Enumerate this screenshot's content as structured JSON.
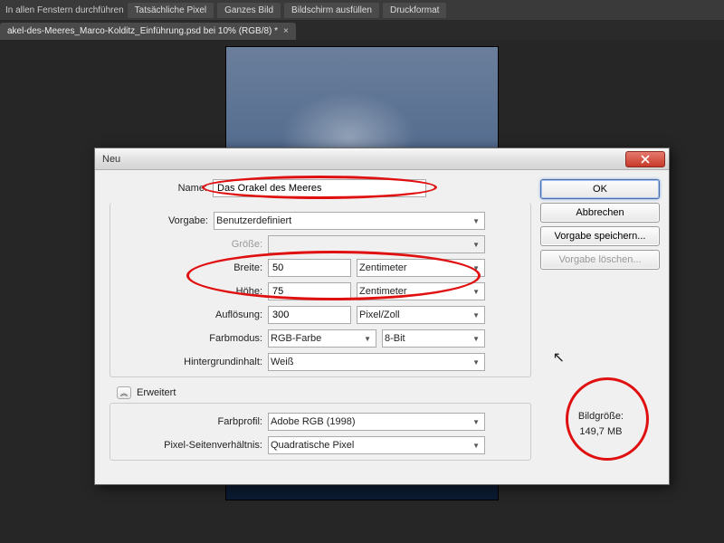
{
  "toolbar": {
    "allWindows": "In allen Fenstern durchführen",
    "btns": [
      "Tatsächliche Pixel",
      "Ganzes Bild",
      "Bildschirm ausfüllen",
      "Druckformat"
    ]
  },
  "tab": {
    "label": "akel-des-Meeres_Marco-Kolditz_Einführung.psd bei 10% (RGB/8) *",
    "close": "×"
  },
  "dialog": {
    "title": "Neu",
    "labels": {
      "name": "Name:",
      "preset": "Vorgabe:",
      "size": "Größe:",
      "width": "Breite:",
      "height": "Höhe:",
      "resolution": "Auflösung:",
      "colormode": "Farbmodus:",
      "bgcontent": "Hintergrundinhalt:",
      "advanced": "Erweitert",
      "colorprofile": "Farbprofil:",
      "pixelaspect": "Pixel-Seitenverhältnis:"
    },
    "values": {
      "name": "Das Orakel des Meeres",
      "preset": "Benutzerdefiniert",
      "size": "",
      "width": "50",
      "widthUnit": "Zentimeter",
      "height": "75",
      "heightUnit": "Zentimeter",
      "resolution": "300",
      "resolutionUnit": "Pixel/Zoll",
      "colormode": "RGB-Farbe",
      "bitdepth": "8-Bit",
      "bgcontent": "Weiß",
      "colorprofile": "Adobe RGB (1998)",
      "pixelaspect": "Quadratische Pixel"
    },
    "buttons": {
      "ok": "OK",
      "cancel": "Abbrechen",
      "savePreset": "Vorgabe speichern...",
      "deletePreset": "Vorgabe löschen..."
    },
    "imageSize": {
      "label": "Bildgröße:",
      "value": "149,7 MB"
    }
  }
}
